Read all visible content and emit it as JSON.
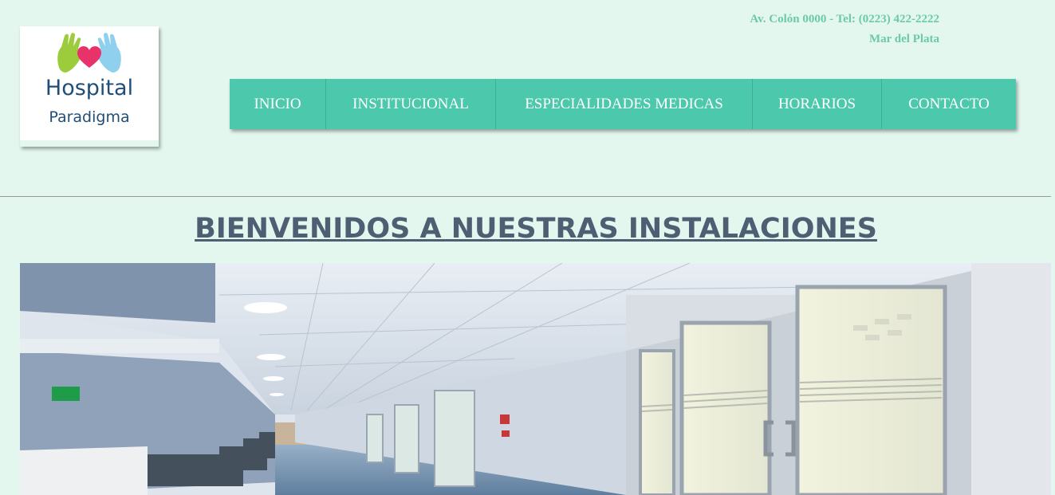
{
  "logo": {
    "title": "Hospital",
    "subtitle": "Paradigma",
    "icon": "hands-heart-logo"
  },
  "contact": {
    "address_phone": "Av. Colón 0000 - Tel: (0223) 422-2222",
    "city": "Mar del Plata"
  },
  "nav": {
    "items": [
      {
        "label": "INICIO"
      },
      {
        "label": "INSTITUCIONAL"
      },
      {
        "label": "ESPECIALIDADES MEDICAS"
      },
      {
        "label": "HORARIOS"
      },
      {
        "label": "CONTACTO"
      }
    ]
  },
  "main": {
    "heading": "BIENVENIDOS A NUESTRAS INSTALACIONES"
  },
  "colors": {
    "background": "#e3f7ee",
    "nav": "#4cc9ad",
    "contact_text": "#6cc9a9",
    "heading": "#4f5f73"
  }
}
